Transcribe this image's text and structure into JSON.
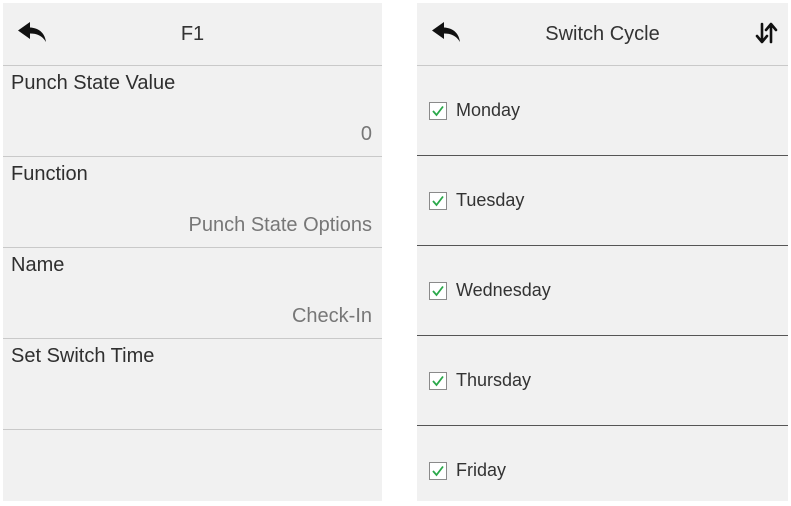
{
  "left_panel": {
    "header": {
      "title": "F1",
      "back_icon": "back-arrow-icon"
    },
    "settings": [
      {
        "label": "Punch State Value",
        "value": "0"
      },
      {
        "label": "Function",
        "value": "Punch State Options"
      },
      {
        "label": "Name",
        "value": "Check-In"
      },
      {
        "label": "Set Switch Time",
        "value": ""
      }
    ]
  },
  "right_panel": {
    "header": {
      "title": "Switch Cycle",
      "back_icon": "back-arrow-icon",
      "sort_icon": "sort-arrows-icon"
    },
    "days": [
      {
        "label": "Monday",
        "checked": true
      },
      {
        "label": "Tuesday",
        "checked": true
      },
      {
        "label": "Wednesday",
        "checked": true
      },
      {
        "label": "Thursday",
        "checked": true
      },
      {
        "label": "Friday",
        "checked": true
      }
    ]
  },
  "colors": {
    "panel_background": "#f1f1f1",
    "divider": "#c9c9c9",
    "checkmark": "#2aa84a"
  }
}
